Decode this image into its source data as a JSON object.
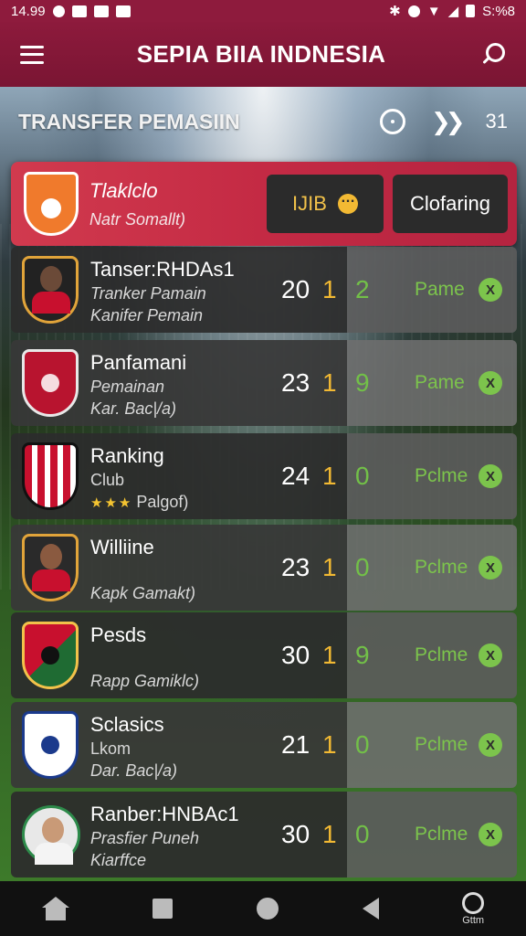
{
  "status_bar": {
    "time": "14.99",
    "right_text": "S:%8"
  },
  "app_bar": {
    "title": "SEPIA BIIA INDNESIA"
  },
  "section": {
    "title": "TRANSFER PEMASIIN",
    "count": "31"
  },
  "featured": {
    "name": "Tlaklclo",
    "subtitle": "Natr Somallt)",
    "button_primary": "IJIB",
    "button_secondary": "Clofaring"
  },
  "rows": [
    {
      "name": "Tanser:RHDAs1",
      "line2": "Tranker Pamain",
      "line3": "Kanifer Pemain",
      "n1": "20",
      "n2": "1",
      "n3": "2",
      "status": "Pame",
      "x": "X"
    },
    {
      "name": "Panfamani",
      "line2": "Pemainan",
      "line3": "Kar. Bac|/a)",
      "n1": "23",
      "n2": "1",
      "n3": "9",
      "status": "Pame",
      "x": "X"
    },
    {
      "name": "Ranking",
      "line2": "Club",
      "line3": "Palgof)",
      "n1": "24",
      "n2": "1",
      "n3": "0",
      "status": "Pclme",
      "x": "X"
    },
    {
      "name": "Williine",
      "line2": "",
      "line3": "Kapk Gamakt)",
      "n1": "23",
      "n2": "1",
      "n3": "0",
      "status": "Pclme",
      "x": "X"
    },
    {
      "name": "Pesds",
      "line2": "",
      "line3": "Rapp Gamiklc)",
      "n1": "30",
      "n2": "1",
      "n3": "9",
      "status": "Pclme",
      "x": "X"
    },
    {
      "name": "Sclasics",
      "line2": "Lkom",
      "line3": "Dar. Bac|/a)",
      "n1": "21",
      "n2": "1",
      "n3": "0",
      "status": "Pclme",
      "x": "X"
    },
    {
      "name": "Ranber:HNBAc1",
      "line2": "Prasfier Puneh",
      "line3": "Kiarffce",
      "n1": "30",
      "n2": "1",
      "n3": "0",
      "status": "Pclme",
      "x": "X"
    }
  ],
  "nav_bar": {
    "search_label": "Gttm"
  },
  "colors": {
    "brand": "#8e1b3d",
    "accent_red": "#c42a44",
    "status_green": "#7cc44c",
    "value_gold": "#f2b933"
  }
}
